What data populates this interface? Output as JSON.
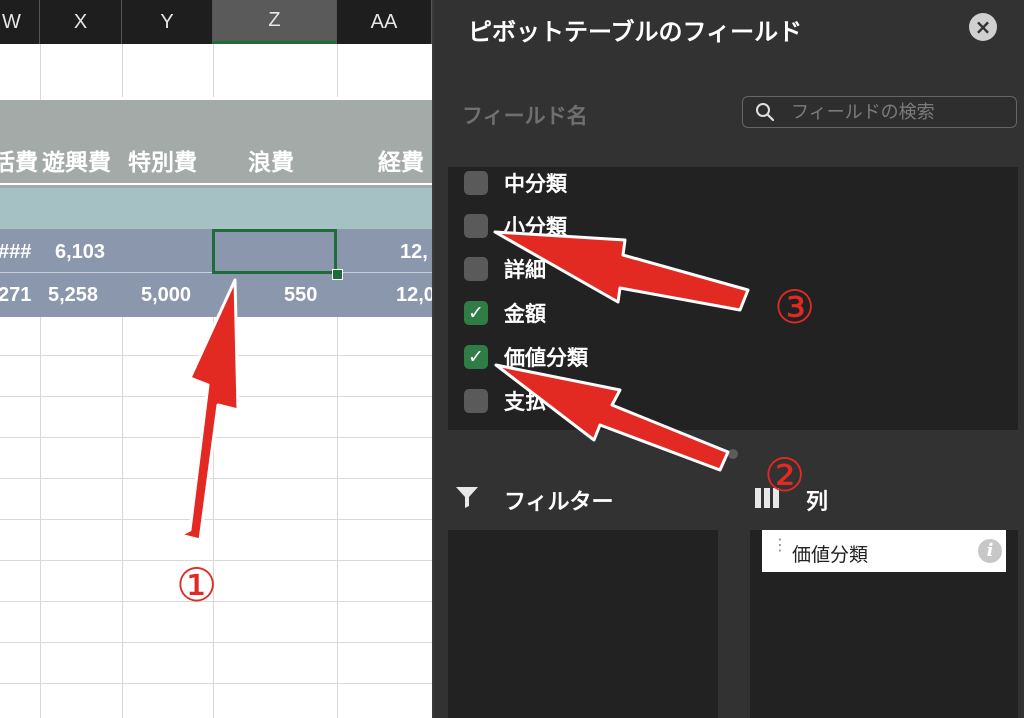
{
  "sheet": {
    "columns": [
      "W",
      "X",
      "Y",
      "Z",
      "AA"
    ],
    "selected_column": "Z",
    "header_labels": [
      "活費",
      "遊興費",
      "特別費",
      "浪費",
      "経費"
    ],
    "row1": [
      "###",
      "6,103",
      "",
      "",
      "12,"
    ],
    "row2": [
      "271",
      "5,258",
      "5,000",
      "550",
      "12,0"
    ]
  },
  "panel": {
    "title": "ピボットテーブルのフィールド",
    "close_icon": "×",
    "field_name_label": "フィールド名",
    "search_placeholder": "フィールドの検索",
    "fields": [
      {
        "label": "中分類",
        "checked": false
      },
      {
        "label": "小分類",
        "checked": false
      },
      {
        "label": "詳細",
        "checked": false
      },
      {
        "label": "金額",
        "checked": true
      },
      {
        "label": "価値分類",
        "checked": true
      },
      {
        "label": "支払",
        "checked": false
      }
    ],
    "filters_label": "フィルター",
    "columns_label": "列",
    "column_chip": "価値分類",
    "info_icon": "i"
  },
  "annotations": [
    "①",
    "②",
    "③"
  ],
  "colors": {
    "annotation_red": "#e22a22",
    "check_green": "#2f7d45",
    "selection_green": "#1f6b3a",
    "header_band": "#a3aaa8",
    "teal_band": "#a6c1c4",
    "data_band": "#8b97ad"
  }
}
